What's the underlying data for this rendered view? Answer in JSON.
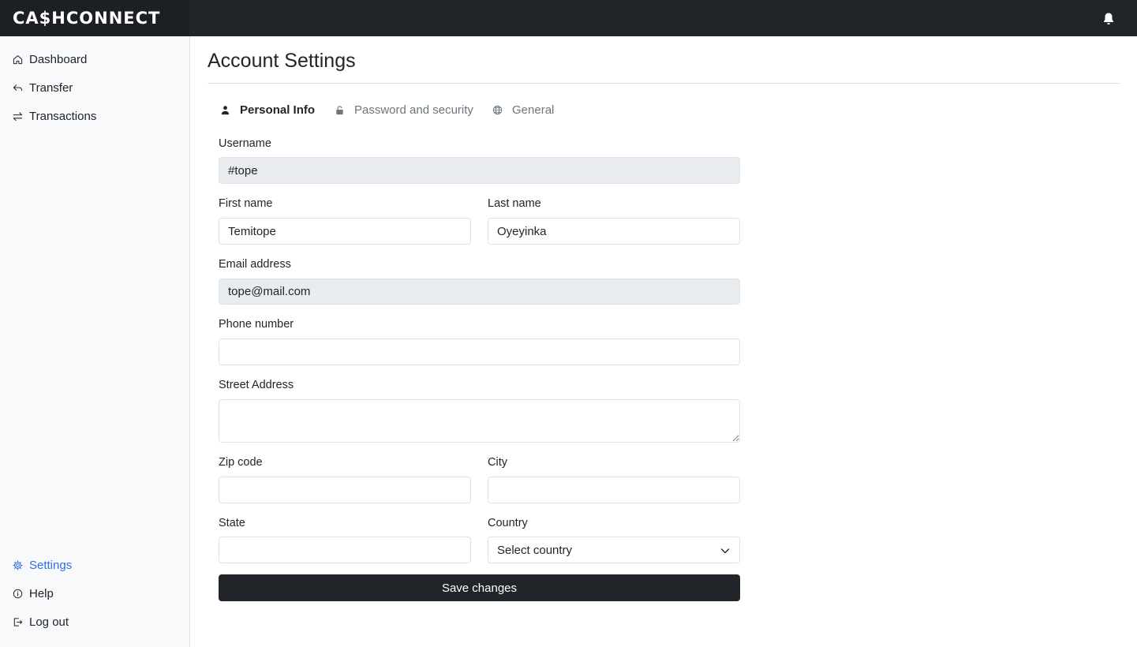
{
  "app": {
    "brand": "CA$HCONNECT"
  },
  "header": {
    "notifications_icon": "bell-icon"
  },
  "sidebar": {
    "top_items": [
      {
        "label": "Dashboard",
        "icon": "home-icon"
      },
      {
        "label": "Transfer",
        "icon": "reply-arrow-icon"
      },
      {
        "label": "Transactions",
        "icon": "swap-arrows-icon"
      }
    ],
    "bottom_items": [
      {
        "label": "Settings",
        "icon": "gear-icon",
        "active": true
      },
      {
        "label": "Help",
        "icon": "info-circle-icon"
      },
      {
        "label": "Log out",
        "icon": "logout-icon"
      }
    ],
    "active_color": "#2f6fe0"
  },
  "page": {
    "title": "Account Settings",
    "tabs": [
      {
        "label": "Personal Info",
        "icon": "person-icon",
        "active": true
      },
      {
        "label": "Password and security",
        "icon": "lock-icon",
        "active": false
      },
      {
        "label": "General",
        "icon": "globe-icon",
        "active": false
      }
    ]
  },
  "form": {
    "username": {
      "label": "Username",
      "value": "#tope",
      "disabled": true
    },
    "first_name": {
      "label": "First name",
      "value": "Temitope"
    },
    "last_name": {
      "label": "Last name",
      "value": "Oyeyinka"
    },
    "email": {
      "label": "Email address",
      "value": "tope@mail.com",
      "disabled": true
    },
    "phone": {
      "label": "Phone number",
      "value": ""
    },
    "street": {
      "label": "Street Address",
      "value": ""
    },
    "zip": {
      "label": "Zip code",
      "value": ""
    },
    "city": {
      "label": "City",
      "value": ""
    },
    "state": {
      "label": "State",
      "value": ""
    },
    "country": {
      "label": "Country",
      "selected": "Select country"
    },
    "save_label": "Save changes"
  }
}
